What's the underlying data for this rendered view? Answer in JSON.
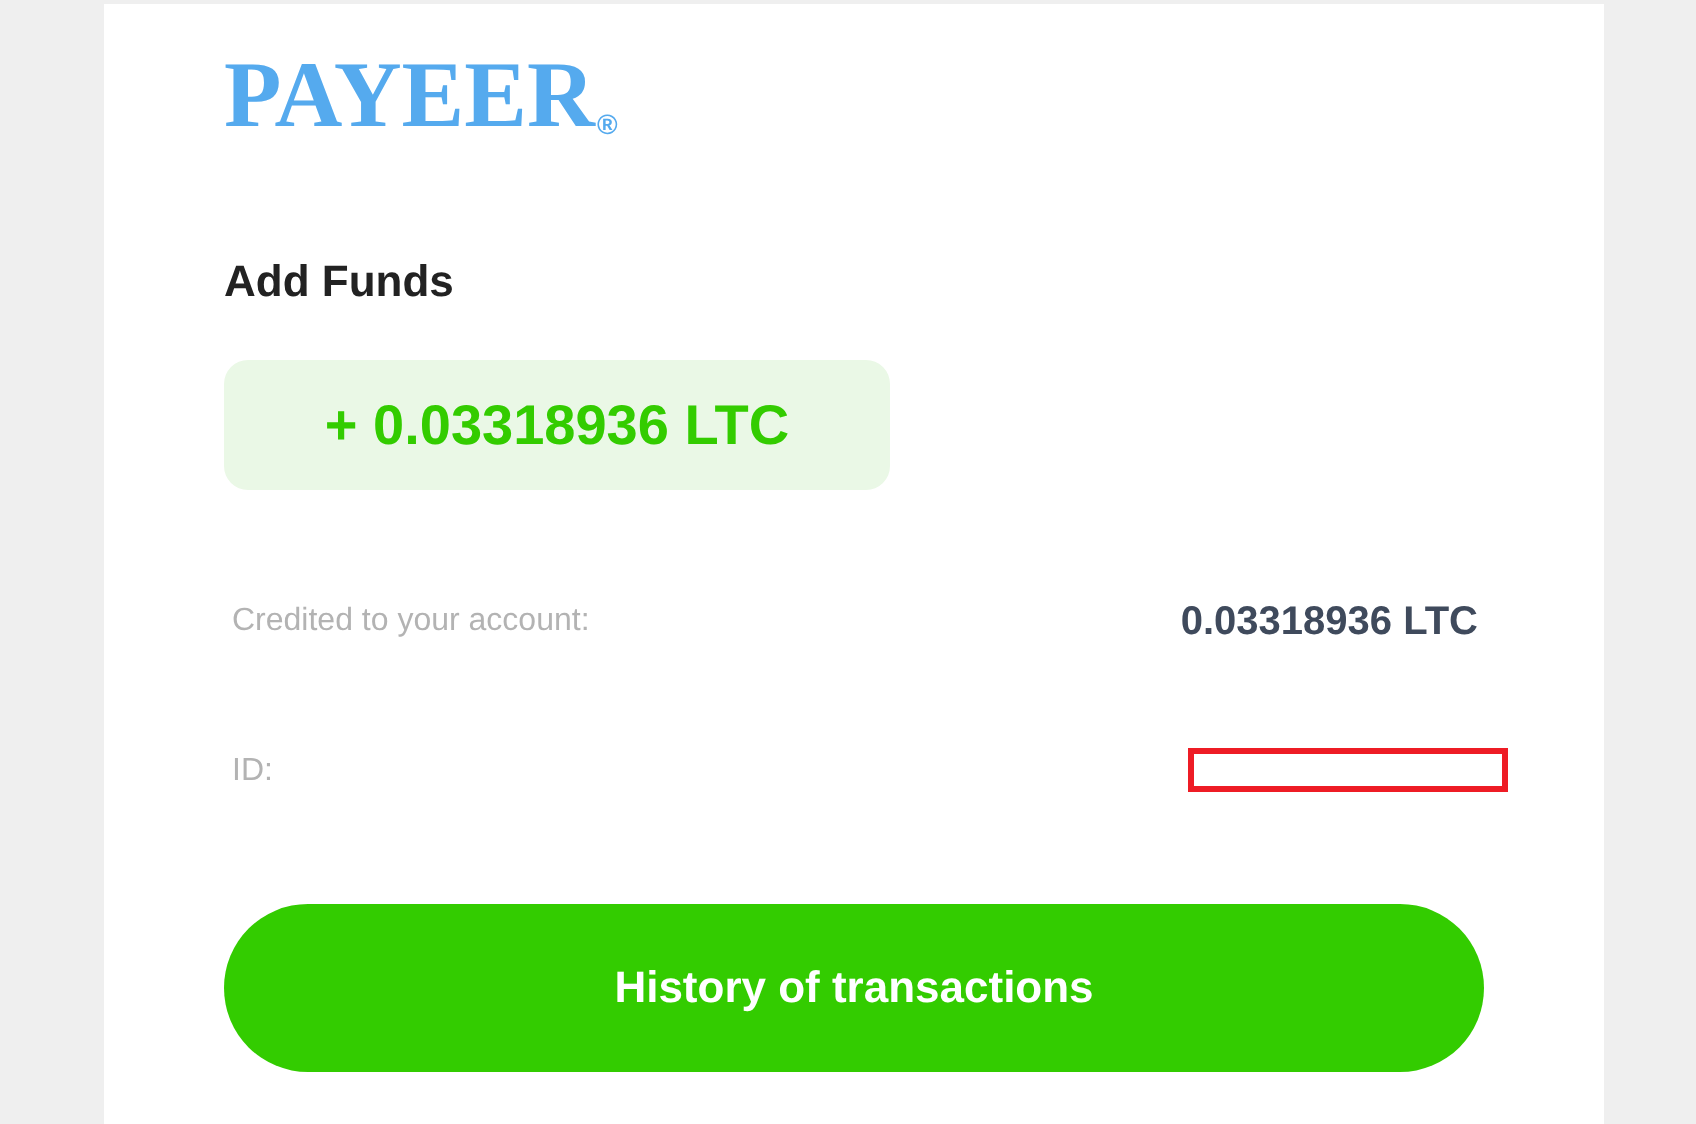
{
  "logo": {
    "name": "PAYEER",
    "mark": "®"
  },
  "title": "Add Funds",
  "amount": "+ 0.03318936 LTC",
  "details": [
    {
      "label": "Credited to your account:",
      "value": "0.03318936 LTC",
      "kind": "text"
    },
    {
      "label": "ID:",
      "kind": "redacted"
    }
  ],
  "button": "History of transactions"
}
